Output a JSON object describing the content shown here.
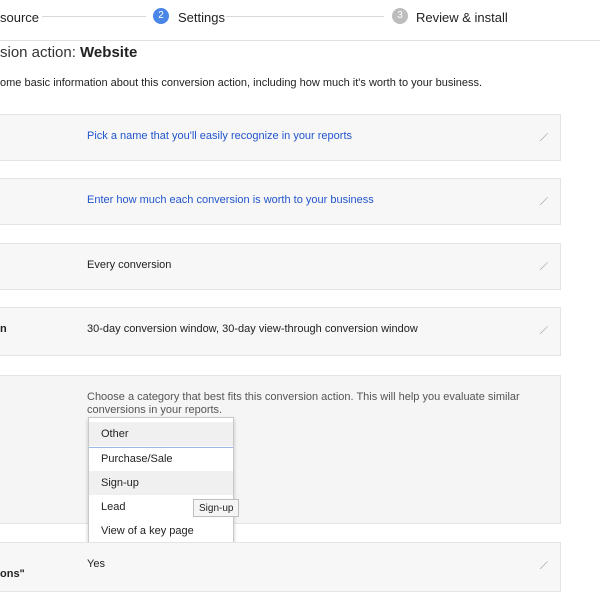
{
  "stepper": {
    "steps": [
      {
        "label": "source",
        "number": ""
      },
      {
        "label": "Settings",
        "number": "2"
      },
      {
        "label": "Review & install",
        "number": "3"
      }
    ]
  },
  "header": {
    "title_prefix": "sion action: ",
    "title_suffix": "Website",
    "description": "ome basic information about this conversion action, including how much it's worth to your business."
  },
  "rows": {
    "name": {
      "label": "",
      "value": "Pick a name that you'll easily recognize in your reports"
    },
    "value": {
      "label": "",
      "value": "Enter how much each conversion is worth to your business"
    },
    "count": {
      "label": "",
      "value": "Every conversion"
    },
    "window": {
      "label": "n",
      "value": "30-day conversion window, 30-day view-through conversion window"
    },
    "category": {
      "label": "",
      "description": "Choose a category that best fits this conversion action. This will help you evaluate similar conversions in your reports.",
      "options": [
        "Other",
        "Purchase/Sale",
        "Sign-up",
        "Lead",
        "View of a key page"
      ],
      "selected": "Other",
      "hovered": "Sign-up",
      "tooltip": "Sign-up"
    },
    "include": {
      "label": "ons\"",
      "value": "Yes"
    }
  },
  "colors": {
    "accent": "#4a86e8",
    "inactive_step": "#bdbdbd",
    "link": "#2255cc"
  },
  "icons": {
    "edit": "pencil-icon"
  }
}
